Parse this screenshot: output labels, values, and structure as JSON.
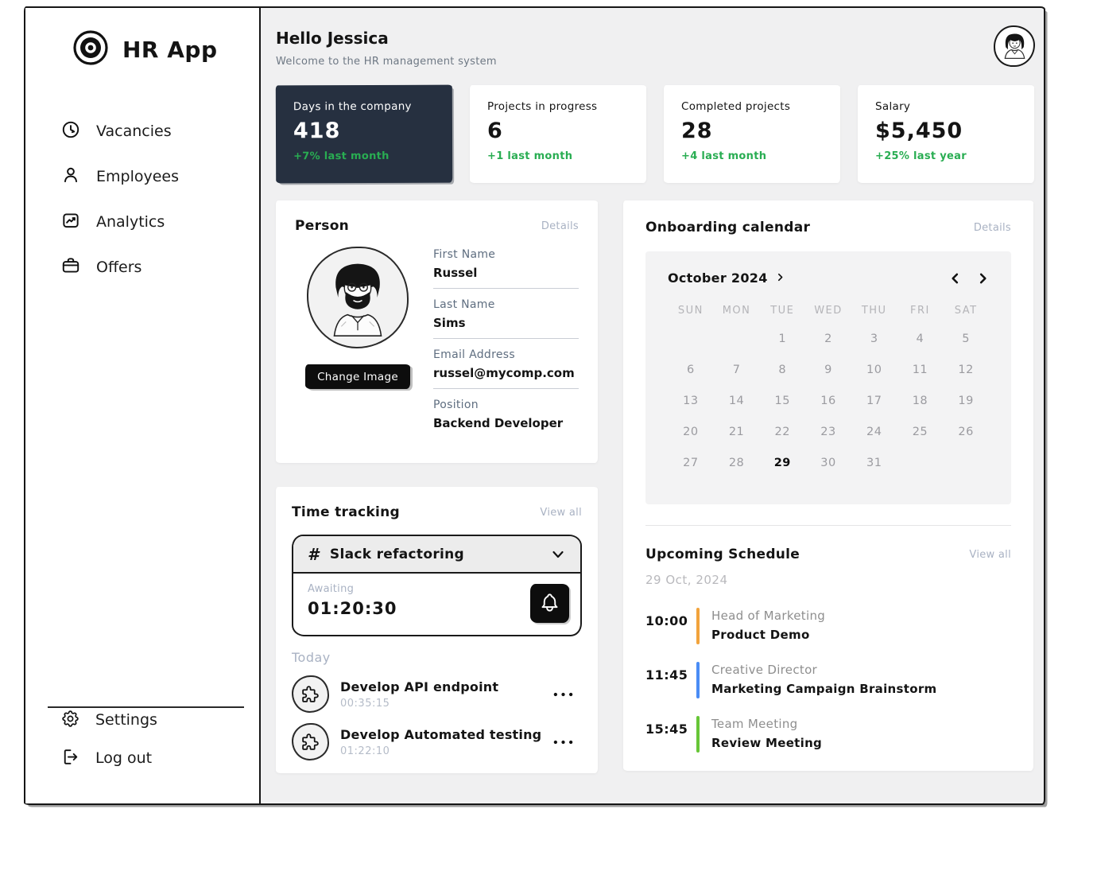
{
  "app": {
    "name": "HR App"
  },
  "header": {
    "greeting": "Hello Jessica",
    "subtitle": "Welcome to the HR management system"
  },
  "sidebar": {
    "items": [
      {
        "id": "vacancies",
        "icon": "clock-icon",
        "label": "Vacancies"
      },
      {
        "id": "employees",
        "icon": "person-icon",
        "label": "Employees"
      },
      {
        "id": "analytics",
        "icon": "chart-icon",
        "label": "Analytics"
      },
      {
        "id": "offers",
        "icon": "briefcase-icon",
        "label": "Offers"
      }
    ],
    "footer_items": [
      {
        "id": "settings",
        "icon": "gear-icon",
        "label": "Settings"
      },
      {
        "id": "logout",
        "icon": "logout-icon",
        "label": "Log out"
      }
    ]
  },
  "stats": [
    {
      "label": "Days in the company",
      "value": "418",
      "delta": "+7% last month",
      "dark": true
    },
    {
      "label": "Projects in progress",
      "value": "6",
      "delta": "+1 last month",
      "dark": false
    },
    {
      "label": "Completed projects",
      "value": "28",
      "delta": "+4 last month",
      "dark": false
    },
    {
      "label": "Salary",
      "value": "$5,450",
      "delta": "+25% last year",
      "dark": false
    }
  ],
  "person": {
    "title": "Person",
    "details_label": "Details",
    "change_image_label": "Change Image",
    "fields": [
      {
        "label": "First Name",
        "value": "Russel"
      },
      {
        "label": "Last Name",
        "value": "Sims"
      },
      {
        "label": "Email Address",
        "value": "russel@mycomp.com"
      },
      {
        "label": "Position",
        "value": "Backend Developer"
      }
    ]
  },
  "calendar": {
    "title": "Onboarding calendar",
    "details_label": "Details",
    "month_label": "October 2024",
    "day_headers": [
      "SUN",
      "MON",
      "TUE",
      "WED",
      "THU",
      "FRI",
      "SAT"
    ],
    "weeks": [
      [
        "",
        "",
        "1",
        "2",
        "3",
        "4",
        "5"
      ],
      [
        "6",
        "7",
        "8",
        "9",
        "10",
        "11",
        "12"
      ],
      [
        "13",
        "14",
        "15",
        "16",
        "17",
        "18",
        "19"
      ],
      [
        "20",
        "21",
        "22",
        "23",
        "24",
        "25",
        "26"
      ],
      [
        "27",
        "28",
        "29",
        "30",
        "31",
        "",
        ""
      ]
    ],
    "selected_day": "29"
  },
  "time_tracking": {
    "title": "Time tracking",
    "view_all_label": "View all",
    "selected_task": "Slack refactoring",
    "status_label": "Awaiting",
    "timer": "01:20:30",
    "today_label": "Today",
    "tasks": [
      {
        "title": "Develop API endpoint",
        "time": "00:35:15"
      },
      {
        "title": "Develop Automated testing",
        "time": "01:22:10"
      }
    ]
  },
  "schedule": {
    "title": "Upcoming Schedule",
    "view_all_label": "View all",
    "date": "29 Oct, 2024",
    "events": [
      {
        "time": "10:00",
        "role": "Head of Marketing",
        "title": "Product Demo",
        "color": "#f2a33c"
      },
      {
        "time": "11:45",
        "role": "Creative Director",
        "title": "Marketing Campaign Brainstorm",
        "color": "#4a8cf5"
      },
      {
        "time": "15:45",
        "role": "Team Meeting",
        "title": "Review Meeting",
        "color": "#67c637"
      }
    ]
  },
  "colors": {
    "accent_green": "#29ad52",
    "dark_card_bg": "#263040"
  }
}
